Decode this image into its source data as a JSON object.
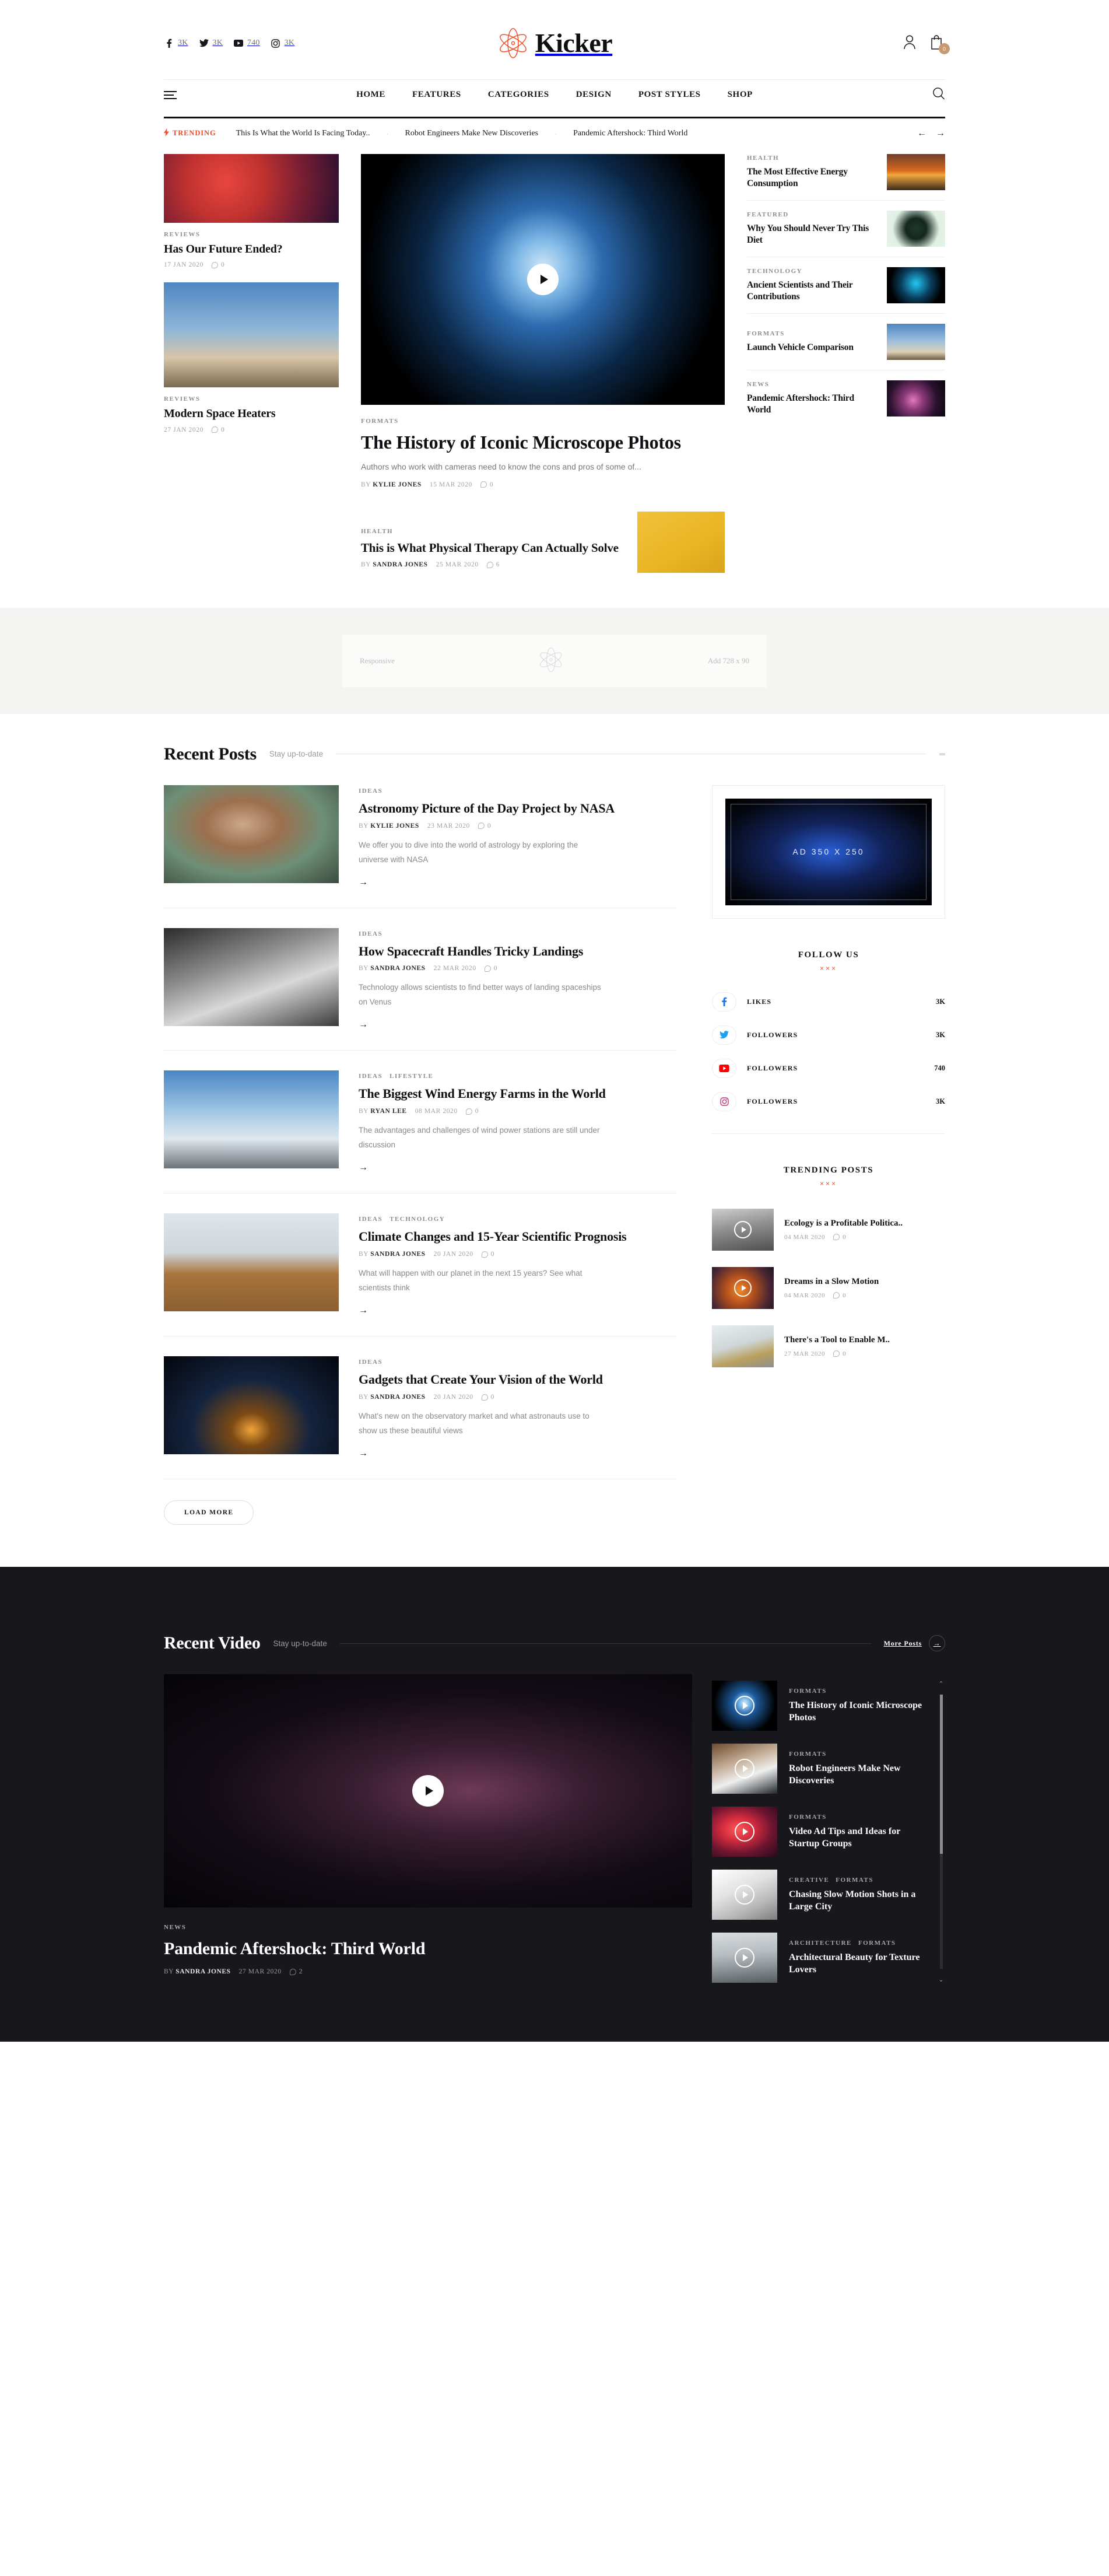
{
  "header": {
    "brand": "Kicker",
    "socials": [
      {
        "icon": "facebook-icon",
        "count": "3K"
      },
      {
        "icon": "twitter-icon",
        "count": "3K"
      },
      {
        "icon": "youtube-icon",
        "count": "740"
      },
      {
        "icon": "instagram-icon",
        "count": "3K"
      }
    ],
    "account_icon": "user-icon",
    "cart_icon": "cart-icon",
    "cart_count": "0"
  },
  "nav": {
    "menu_icon": "hamburger-icon",
    "search_icon": "search-icon",
    "items": [
      "HOME",
      "FEATURES",
      "CATEGORIES",
      "DESIGN",
      "POST STYLES",
      "SHOP"
    ]
  },
  "trending": {
    "label": "TRENDING",
    "bolt_icon": "lightning-icon",
    "items": [
      "This Is What the World Is Facing Today..",
      "Robot Engineers Make New Discoveries",
      "Pandemic Aftershock: Third World"
    ],
    "prev_icon": "arrow-left-icon",
    "next_icon": "arrow-right-icon"
  },
  "hero": {
    "left": [
      {
        "category": "REVIEWS",
        "title": "Has Our Future Ended?",
        "date": "17 JAN 2020",
        "comments": "0"
      },
      {
        "category": "REVIEWS",
        "title": "Modern Space Heaters",
        "date": "27 JAN 2020",
        "comments": "0"
      }
    ],
    "center": {
      "play_icon": "play-icon",
      "category": "FORMATS",
      "title": "The History of Iconic Microscope Photos",
      "excerpt": "Authors who work with cameras need to know the cons and pros of some of...",
      "by_label": "BY",
      "author": "KYLIE JONES",
      "date": "15 MAR 2020",
      "comments": "0"
    },
    "sub": {
      "category": "HEALTH",
      "title": "This is What Physical Therapy Can Actually Solve",
      "by_label": "BY",
      "author": "SANDRA JONES",
      "date": "25 MAR 2020",
      "comments": "6"
    },
    "right": [
      {
        "category": "HEALTH",
        "title": "The Most Effective Energy Consumption"
      },
      {
        "category": "FEATURED",
        "title": "Why You Should Never Try This Diet"
      },
      {
        "category": "TECHNOLOGY",
        "title": "Ancient Scientists and Their Contributions"
      },
      {
        "category": "FORMATS",
        "title": "Launch Vehicle Comparison"
      },
      {
        "category": "NEWS",
        "title": "Pandemic Aftershock: Third World"
      }
    ]
  },
  "ad_strip": {
    "left_label": "Responsive",
    "right_label": "Add 728 x 90",
    "logo_icon": "atom-icon"
  },
  "recent_posts": {
    "title": "Recent Posts",
    "subtitle": "Stay up-to-date",
    "load_more": "LOAD MORE",
    "arrow_icon": "arrow-right-icon",
    "items": [
      {
        "category": "IDEAS",
        "category2": "",
        "title": "Astronomy Picture of the Day Project by NASA",
        "by_label": "BY",
        "author": "KYLIE JONES",
        "date": "23 MAR 2020",
        "comments": "0",
        "excerpt": "We offer you to dive into the world of astrology by exploring the universe with NASA"
      },
      {
        "category": "IDEAS",
        "category2": "",
        "title": "How Spacecraft Handles Tricky Landings",
        "by_label": "BY",
        "author": "SANDRA JONES",
        "date": "22 MAR 2020",
        "comments": "0",
        "excerpt": "Technology allows scientists to find better ways of landing spaceships on Venus"
      },
      {
        "category": "IDEAS",
        "category2": "LIFESTYLE",
        "title": "The Biggest Wind Energy Farms in the World",
        "by_label": "BY",
        "author": "RYAN LEE",
        "date": "08 MAR 2020",
        "comments": "0",
        "excerpt": "The advantages and challenges of wind power stations are still under discussion"
      },
      {
        "category": "IDEAS",
        "category2": "TECHNOLOGY",
        "title": "Climate Changes and 15-Year Scientific Prognosis",
        "by_label": "BY",
        "author": "SANDRA JONES",
        "date": "20 JAN 2020",
        "comments": "0",
        "excerpt": "What will happen with our planet in the next 15 years? See what scientists think"
      },
      {
        "category": "IDEAS",
        "category2": "",
        "title": "Gadgets that Create Your Vision of the World",
        "by_label": "BY",
        "author": "SANDRA JONES",
        "date": "20 JAN 2020",
        "comments": "0",
        "excerpt": "What's new on the observatory market and what astronauts use to show us these beautiful views"
      }
    ]
  },
  "sidebar": {
    "ad_label": "AD 350 X 250",
    "follow": {
      "title": "FOLLOW US",
      "ornament": "×××",
      "rows": [
        {
          "icon": "facebook-icon",
          "label": "LIKES",
          "count": "3K",
          "color": "#1877f2"
        },
        {
          "icon": "twitter-icon",
          "label": "FOLLOWERS",
          "count": "3K",
          "color": "#1da1f2"
        },
        {
          "icon": "youtube-icon",
          "label": "FOLLOWERS",
          "count": "740",
          "color": "#ff0000"
        },
        {
          "icon": "instagram-icon",
          "label": "FOLLOWERS",
          "count": "3K",
          "color": "#c13584"
        }
      ]
    },
    "trending": {
      "title": "TRENDING POSTS",
      "ornament": "×××",
      "items": [
        {
          "title": "Ecology is a Profitable Politica..",
          "date": "04 MAR 2020",
          "comments": "0",
          "has_play": true
        },
        {
          "title": "Dreams in a Slow Motion",
          "date": "04 MAR 2020",
          "comments": "0",
          "has_play": true
        },
        {
          "title": "There's a Tool to Enable M..",
          "date": "27 MAR 2020",
          "comments": "0",
          "has_play": false
        }
      ]
    }
  },
  "recent_video": {
    "title": "Recent Video",
    "subtitle": "Stay up-to-date",
    "more_posts": "More Posts",
    "arrow_icon": "arrow-right-icon",
    "play_icon": "play-icon",
    "featured": {
      "category": "NEWS",
      "title": "Pandemic Aftershock: Third World",
      "by_label": "BY",
      "author": "SANDRA JONES",
      "date": "27 MAR 2020",
      "comments": "2"
    },
    "playlist": [
      {
        "category": "FORMATS",
        "category2": "",
        "title": "The History of Iconic Microscope Photos"
      },
      {
        "category": "FORMATS",
        "category2": "",
        "title": "Robot Engineers Make New Discoveries"
      },
      {
        "category": "FORMATS",
        "category2": "",
        "title": "Video Ad Tips and Ideas for Startup Groups"
      },
      {
        "category": "CREATIVE",
        "category2": "FORMATS",
        "title": "Chasing Slow Motion Shots in a Large City"
      },
      {
        "category": "ARCHITECTURE",
        "category2": "FORMATS",
        "title": "Architectural Beauty for Texture Lovers"
      }
    ],
    "scroll_up_icon": "chevron-up-icon",
    "scroll_down_icon": "chevron-down-icon"
  },
  "colors": {
    "accent": "#f04a23",
    "dark": "#17171c",
    "cart_badge": "#c79a73"
  }
}
